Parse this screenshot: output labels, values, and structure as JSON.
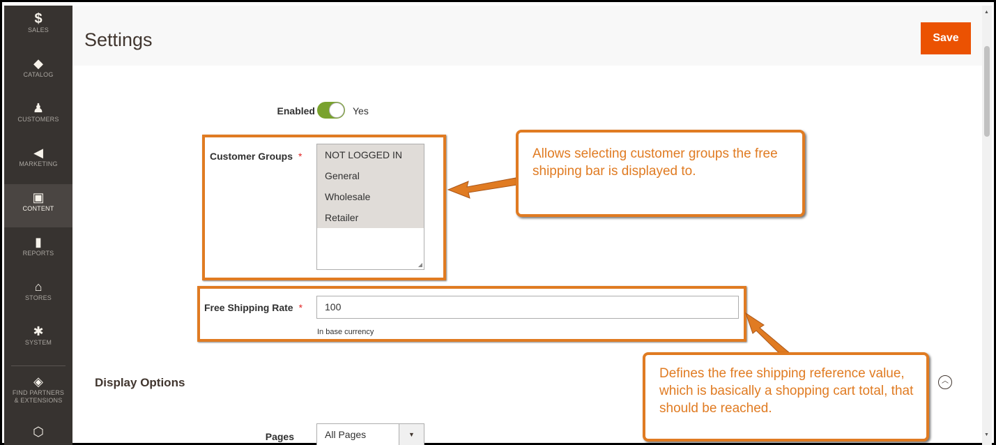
{
  "sidebar": {
    "items": [
      {
        "icon": "$",
        "icon_name": "dollar-icon",
        "label": "SALES"
      },
      {
        "icon": "◆",
        "icon_name": "cube-icon",
        "label": "CATALOG"
      },
      {
        "icon": "♟",
        "icon_name": "person-icon",
        "label": "CUSTOMERS"
      },
      {
        "icon": "◀",
        "icon_name": "megaphone-icon",
        "label": "MARKETING"
      },
      {
        "icon": "▣",
        "icon_name": "layout-icon",
        "label": "CONTENT"
      },
      {
        "icon": "▮",
        "icon_name": "bar-chart-icon",
        "label": "REPORTS"
      },
      {
        "icon": "⌂",
        "icon_name": "store-icon",
        "label": "STORES"
      },
      {
        "icon": "✱",
        "icon_name": "gear-icon",
        "label": "SYSTEM"
      },
      {
        "icon": "◈",
        "icon_name": "partners-icon",
        "label": "FIND PARTNERS\n& EXTENSIONS"
      },
      {
        "icon": "⬡",
        "icon_name": "hexagon-icon",
        "label": ""
      }
    ],
    "active": "CONTENT"
  },
  "header": {
    "title": "Settings",
    "save_label": "Save"
  },
  "form": {
    "enabled": {
      "label": "Enabled",
      "value": "Yes",
      "on": true
    },
    "customer_groups": {
      "label": "Customer Groups",
      "required_mark": "*",
      "options": [
        "NOT LOGGED IN",
        "General",
        "Wholesale",
        "Retailer"
      ]
    },
    "free_shipping_rate": {
      "label": "Free Shipping Rate",
      "required_mark": "*",
      "value": "100",
      "note": "In base currency"
    },
    "display_options": {
      "title": "Display Options"
    },
    "pages": {
      "label": "Pages",
      "value": "All Pages"
    }
  },
  "annotations": {
    "callout_1": "Allows selecting customer groups the free shipping bar is displayed to.",
    "callout_2": "Defines the free shipping reference value, which is basically a shopping cart total, that should be reached."
  },
  "colors": {
    "accent": "#eb5202",
    "sidebar_bg": "#373330",
    "toggle_on": "#79a22e",
    "annotation": "#e07b22",
    "required": "#e22626"
  }
}
